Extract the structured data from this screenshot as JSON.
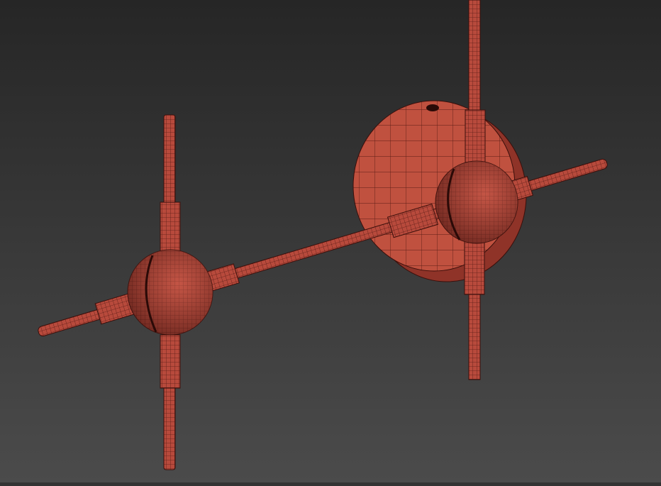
{
  "viewport": {
    "background_top": "#262626",
    "background_bottom": "#4b4b4b",
    "model_color": "#b84a3c",
    "model_highlight": "#d0604f",
    "wire_color": "#5a1c16"
  }
}
